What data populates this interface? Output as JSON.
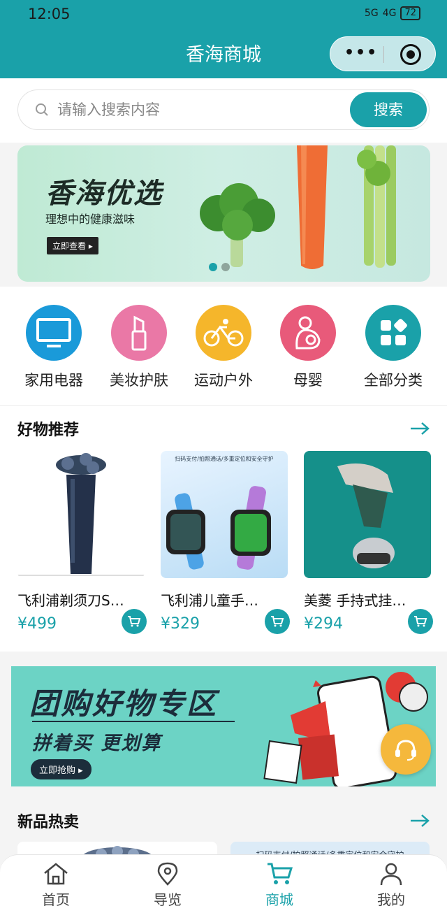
{
  "status_bar": {
    "time": "12:05",
    "battery": "72",
    "signal1": "5G",
    "signal2": "4G"
  },
  "header": {
    "title": "香海商城",
    "more_icon": "more-dots-icon",
    "target_icon": "target-icon"
  },
  "search": {
    "placeholder": "请输入搜索内容",
    "value": "",
    "button_label": "搜索"
  },
  "banner": {
    "title": "香海优选",
    "subtitle": "理想中的健康滋味",
    "button_label": "立即查看 ▸",
    "slide_count": 2,
    "active_slide": 0
  },
  "categories": [
    {
      "label": "家用电器",
      "icon": "tv-icon",
      "color": "#1a9ad9"
    },
    {
      "label": "美妆护肤",
      "icon": "lipstick-icon",
      "color": "#ea78a6"
    },
    {
      "label": "运动户外",
      "icon": "bicycle-icon",
      "color": "#f5b62b"
    },
    {
      "label": "母婴",
      "icon": "mother-baby-icon",
      "color": "#e85a7a"
    },
    {
      "label": "全部分类",
      "icon": "grid-icon",
      "color": "#1aa1a9"
    }
  ],
  "recommend": {
    "title": "好物推荐",
    "products": [
      {
        "name": "飞利浦剃须刀S…",
        "price": "¥499"
      },
      {
        "name": "飞利浦儿童手…",
        "price": "¥329"
      },
      {
        "name": "美菱 手持式挂…",
        "price": "¥294"
      }
    ],
    "watch_caption": "扫码支付/拍照通话/多重定位和安全守护"
  },
  "group_banner": {
    "title": "团购好物专区",
    "subtitle": "拼着买 更划算",
    "button_label": "立即抢购 ▸"
  },
  "new_hot": {
    "title": "新品热卖",
    "preview_caption": "扫码支付/拍照通话/多重定位和安全守护"
  },
  "tabbar": [
    {
      "label": "首页",
      "icon": "home-icon",
      "active": false
    },
    {
      "label": "导览",
      "icon": "location-pin-icon",
      "active": false
    },
    {
      "label": "商城",
      "icon": "cart-icon",
      "active": true
    },
    {
      "label": "我的",
      "icon": "user-icon",
      "active": false
    }
  ],
  "colors": {
    "accent": "#1aa1a9",
    "price": "#1aa1a9",
    "service_button": "#f5b83c"
  }
}
